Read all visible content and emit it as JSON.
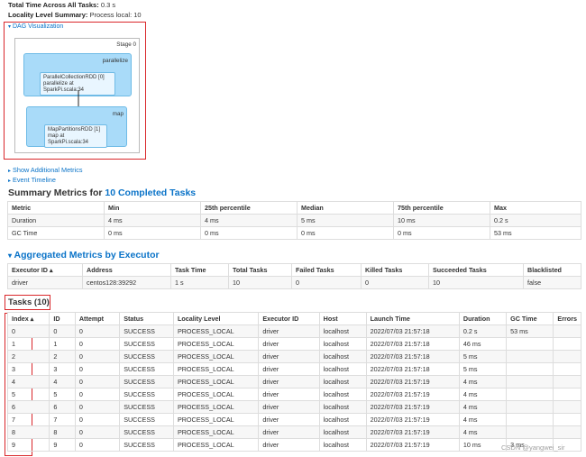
{
  "header": {
    "total_time_label": "Total Time Across All Tasks:",
    "total_time_value": "0.3 s",
    "locality_label": "Locality Level Summary:",
    "locality_value": "Process local: 10"
  },
  "dag": {
    "toggle_label": "DAG Visualization",
    "stage_label": "Stage 0",
    "clusters": [
      {
        "label": "parallelize",
        "rdd_line1": "ParallelCollectionRDD [0]",
        "rdd_line2": "parallelize at SparkPi.scala:34"
      },
      {
        "label": "map",
        "rdd_line1": "MapPartitionsRDD [1]",
        "rdd_line2": "map at SparkPi.scala:34"
      }
    ]
  },
  "links": {
    "additional_metrics": "Show Additional Metrics",
    "event_timeline": "Event Timeline"
  },
  "summary": {
    "title_prefix": "Summary Metrics for",
    "title_link": "10 Completed Tasks",
    "columns": [
      "Metric",
      "Min",
      "25th percentile",
      "Median",
      "75th percentile",
      "Max"
    ],
    "rows": [
      [
        "Duration",
        "4 ms",
        "4 ms",
        "5 ms",
        "10 ms",
        "0.2 s"
      ],
      [
        "GC Time",
        "0 ms",
        "0 ms",
        "0 ms",
        "0 ms",
        "53 ms"
      ]
    ]
  },
  "aggregated": {
    "title": "Aggregated Metrics by Executor",
    "columns": [
      "Executor ID ▴",
      "Address",
      "Task Time",
      "Total Tasks",
      "Failed Tasks",
      "Killed Tasks",
      "Succeeded Tasks",
      "Blacklisted"
    ],
    "rows": [
      [
        "driver",
        "centos128:39292",
        "1 s",
        "10",
        "0",
        "0",
        "10",
        "false"
      ]
    ]
  },
  "tasks": {
    "title": "Tasks (10)",
    "columns": [
      "Index ▴",
      "ID",
      "Attempt",
      "Status",
      "Locality Level",
      "Executor ID",
      "Host",
      "Launch Time",
      "Duration",
      "GC Time",
      "Errors"
    ],
    "rows": [
      [
        "0",
        "0",
        "0",
        "SUCCESS",
        "PROCESS_LOCAL",
        "driver",
        "localhost",
        "2022/07/03 21:57:18",
        "0.2 s",
        "53 ms",
        ""
      ],
      [
        "1",
        "1",
        "0",
        "SUCCESS",
        "PROCESS_LOCAL",
        "driver",
        "localhost",
        "2022/07/03 21:57:18",
        "46 ms",
        "",
        ""
      ],
      [
        "2",
        "2",
        "0",
        "SUCCESS",
        "PROCESS_LOCAL",
        "driver",
        "localhost",
        "2022/07/03 21:57:18",
        "5 ms",
        "",
        ""
      ],
      [
        "3",
        "3",
        "0",
        "SUCCESS",
        "PROCESS_LOCAL",
        "driver",
        "localhost",
        "2022/07/03 21:57:18",
        "5 ms",
        "",
        ""
      ],
      [
        "4",
        "4",
        "0",
        "SUCCESS",
        "PROCESS_LOCAL",
        "driver",
        "localhost",
        "2022/07/03 21:57:19",
        "4 ms",
        "",
        ""
      ],
      [
        "5",
        "5",
        "0",
        "SUCCESS",
        "PROCESS_LOCAL",
        "driver",
        "localhost",
        "2022/07/03 21:57:19",
        "4 ms",
        "",
        ""
      ],
      [
        "6",
        "6",
        "0",
        "SUCCESS",
        "PROCESS_LOCAL",
        "driver",
        "localhost",
        "2022/07/03 21:57:19",
        "4 ms",
        "",
        ""
      ],
      [
        "7",
        "7",
        "0",
        "SUCCESS",
        "PROCESS_LOCAL",
        "driver",
        "localhost",
        "2022/07/03 21:57:19",
        "4 ms",
        "",
        ""
      ],
      [
        "8",
        "8",
        "0",
        "SUCCESS",
        "PROCESS_LOCAL",
        "driver",
        "localhost",
        "2022/07/03 21:57:19",
        "4 ms",
        "",
        ""
      ],
      [
        "9",
        "9",
        "0",
        "SUCCESS",
        "PROCESS_LOCAL",
        "driver",
        "localhost",
        "2022/07/03 21:57:19",
        "10 ms",
        "3 ms",
        ""
      ]
    ]
  },
  "watermark": "CSDN @yangwei_sir",
  "colors": {
    "link": "#0a73c8",
    "highlight": "#d9262a",
    "cluster": "#a9dbf9"
  }
}
